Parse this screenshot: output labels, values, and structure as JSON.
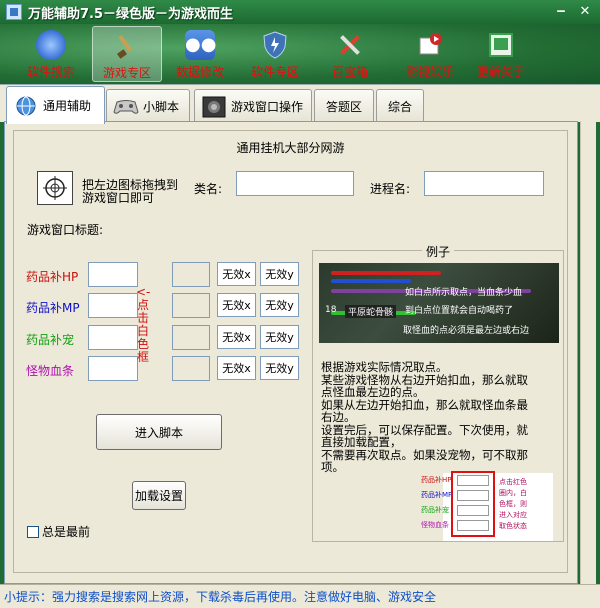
{
  "window": {
    "title": "万能辅助7.5－绿色版－为游戏而生"
  },
  "toolbar": [
    {
      "label": "软件搜索",
      "icon": "orb-icon",
      "color": "#3a6fd6"
    },
    {
      "label": "游戏专区",
      "icon": "brush-icon",
      "color": "#c9a050"
    },
    {
      "label": "数据修改",
      "icon": "users-icon",
      "color": "#3b7ad8"
    },
    {
      "label": "软件专区",
      "icon": "shield-icon",
      "color": "#3f73b8"
    },
    {
      "label": "百宝箱",
      "icon": "tools-icon",
      "color": "#d84030"
    },
    {
      "label": "影视娱乐",
      "icon": "media-icon",
      "color": "#d02828"
    },
    {
      "label": "更新关于",
      "icon": "window-icon",
      "color": "#3aa050"
    }
  ],
  "tabs": [
    {
      "label": "通用辅助"
    },
    {
      "label": "小脚本"
    },
    {
      "label": "游戏窗口操作"
    },
    {
      "label": "答题区"
    },
    {
      "label": "综合"
    }
  ],
  "main": {
    "group_title": "通用挂机大部分网游",
    "drag_hint_1": "把左边图标拖拽到",
    "drag_hint_2": "游戏窗口即可",
    "class_label": "类名:",
    "process_label": "进程名:",
    "window_title_label": "游戏窗口标题:",
    "vertical_note": "<-点击白色框",
    "rows": [
      {
        "label": "药品补HP",
        "color": "#c81010",
        "x_label": "无效x",
        "y_label": "无效y"
      },
      {
        "label": "药品补MP",
        "color": "#1010c8",
        "x_label": "无效x",
        "y_label": "无效y"
      },
      {
        "label": "药品补宠",
        "color": "#10a010",
        "x_label": "无效x",
        "y_label": "无效y"
      },
      {
        "label": "怪物血条",
        "color": "#b010b0",
        "x_label": "无效x",
        "y_label": "无效y"
      }
    ],
    "enter_script_button": "进入脚本",
    "load_settings_button": "加载设置",
    "always_on_top": "总是最前"
  },
  "example": {
    "title": "例子",
    "img_text_1": "如白点所示取点，当血条少血",
    "img_text_2": "到白点位置就会自动喝药了",
    "img_text_3": "取怪血的点必须是最左边或右边",
    "img_text_4": "平原蛇骨骸",
    "img_text_5": "18",
    "lines": [
      "根据游戏实际情况取点。",
      "某些游戏怪物从右边开始扣血，那么就取",
      "点怪血最左边的点。",
      "如果从左边开始扣血，那么就取怪血条最",
      "右边。",
      "设置完后，可以保存配置。下次使用，就",
      "直接加载配置，",
      "不需要再次取点。如果没宠物，可不取那",
      "项。"
    ],
    "mini_labels": [
      "药品补HP",
      "药品补MP",
      "药品补宠",
      "怪物血条"
    ],
    "mini_note": [
      "点击红色",
      "圈内，白",
      "色框，则",
      "进入对应",
      "取色状态"
    ]
  },
  "status": {
    "text": "小提示：强力搜索是搜索网上资源，下载杀毒后再使用。注意做好电脑、游戏安全"
  }
}
